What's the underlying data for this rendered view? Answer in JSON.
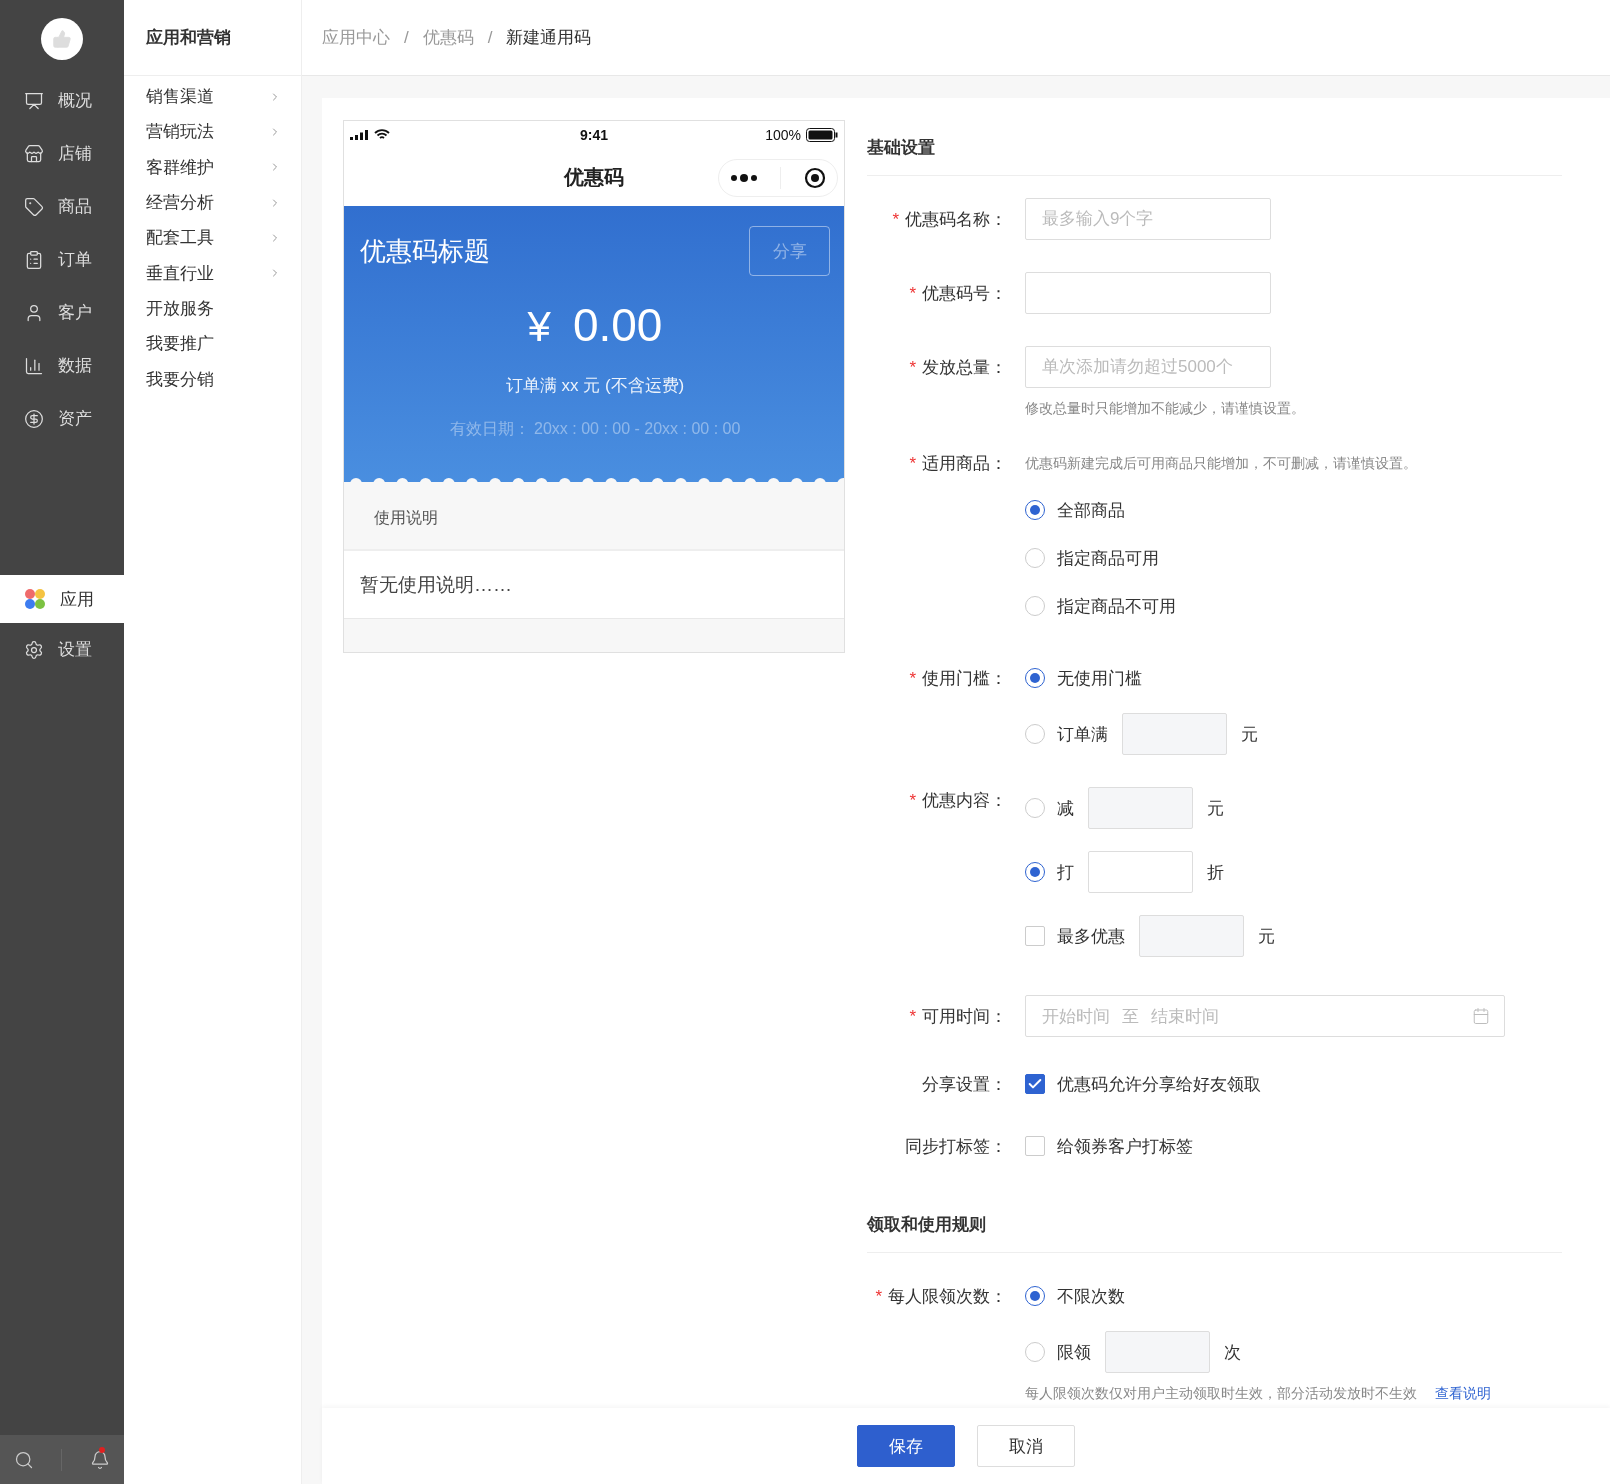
{
  "sidebar": {
    "items": [
      {
        "label": "概况",
        "kind": "overview",
        "selected": false
      },
      {
        "label": "店铺",
        "kind": "store",
        "selected": false
      },
      {
        "label": "商品",
        "kind": "goods",
        "selected": false
      },
      {
        "label": "订单",
        "kind": "order",
        "selected": false
      },
      {
        "label": "客户",
        "kind": "customer",
        "selected": false
      },
      {
        "label": "数据",
        "kind": "data",
        "selected": false
      },
      {
        "label": "资产",
        "kind": "asset",
        "selected": false
      },
      {
        "label": "应用",
        "kind": "apps",
        "selected": true
      },
      {
        "label": "设置",
        "kind": "settings",
        "selected": false
      }
    ],
    "notification_dot": true
  },
  "submenu": {
    "title": "应用和营销",
    "items": [
      {
        "label": "销售渠道",
        "has_children": true
      },
      {
        "label": "营销玩法",
        "has_children": true
      },
      {
        "label": "客群维护",
        "has_children": true
      },
      {
        "label": "经营分析",
        "has_children": true
      },
      {
        "label": "配套工具",
        "has_children": true
      },
      {
        "label": "垂直行业",
        "has_children": true
      },
      {
        "label": "开放服务",
        "has_children": false
      },
      {
        "label": "我要推广",
        "has_children": false
      },
      {
        "label": "我要分销",
        "has_children": false
      }
    ]
  },
  "breadcrumb": {
    "separator": "/",
    "items": [
      "应用中心",
      "优惠码",
      "新建通用码"
    ]
  },
  "preview": {
    "time": "9:41",
    "battery": "100%",
    "nav_title": "优惠码",
    "coupon_title": "优惠码标题",
    "share": "分享",
    "currency": "¥",
    "amount": "0.00",
    "condition": "订单满 xx 元 (不含运费)",
    "validity": "有效日期： 20xx : 00 : 00 - 20xx : 00 : 00",
    "usage_heading": "使用说明",
    "usage_text": "暂无使用说明……"
  },
  "sections": [
    {
      "title": "基础设置",
      "fields": [
        {
          "kind": "input",
          "label": "优惠码名称：",
          "marker": "*",
          "placeholder": "最多输入9个字"
        },
        {
          "kind": "input",
          "label": "优惠码号：",
          "marker": "*"
        },
        {
          "kind": "input",
          "label": "发放总量：",
          "marker": "*",
          "placeholder": "单次添加请勿超过5000个",
          "hint": "修改总量时只能增加不能减少，请谨慎设置。"
        },
        {
          "kind": "choices",
          "label": "适用商品：",
          "marker": "*",
          "note": "优惠码新建完成后可用商品只能增加，不可删减，请谨慎设置。",
          "options": [
            {
              "kind": "radio",
              "label": "全部商品",
              "selected": true
            },
            {
              "kind": "radio",
              "label": "指定商品可用",
              "selected": false
            },
            {
              "kind": "radio",
              "label": "指定商品不可用",
              "selected": false
            }
          ]
        },
        {
          "kind": "choices",
          "label": "使用门槛：",
          "marker": "*",
          "options": [
            {
              "kind": "radio",
              "label": "无使用门槛",
              "selected": true
            },
            {
              "kind": "radio",
              "label": "订单满",
              "selected": false,
              "unit": "元"
            }
          ]
        },
        {
          "kind": "choices",
          "label": "优惠内容：",
          "marker": "*",
          "options": [
            {
              "kind": "radio",
              "label": "减",
              "selected": false,
              "unit": "元"
            },
            {
              "kind": "radio",
              "label": "打",
              "selected": true,
              "unit": "折"
            },
            {
              "kind": "checkbox",
              "label": "最多优惠",
              "selected": false,
              "unit": "元"
            }
          ]
        },
        {
          "kind": "daterange",
          "label": "可用时间：",
          "marker": "*",
          "start": "开始时间",
          "joiner": "至",
          "end": "结束时间"
        },
        {
          "kind": "choices",
          "label": "分享设置：",
          "options": [
            {
              "kind": "checkbox",
              "label": "优惠码允许分享给好友领取",
              "selected": true
            }
          ]
        },
        {
          "kind": "choices",
          "label": "同步打标签：",
          "options": [
            {
              "kind": "checkbox",
              "label": "给领券客户打标签",
              "selected": false
            }
          ]
        }
      ]
    },
    {
      "title": "领取和使用规则",
      "fields": [
        {
          "kind": "choices",
          "label": "每人限领次数：",
          "marker": "*",
          "options": [
            {
              "kind": "radio",
              "label": "不限次数",
              "selected": true
            },
            {
              "kind": "radio",
              "label": "限领",
              "selected": false,
              "unit": "次"
            }
          ],
          "hint": "每人限领次数仅对用户主动领取时生效，部分活动发放时不生效",
          "hint_link": "查看说明"
        }
      ]
    }
  ],
  "footer": {
    "buttons": [
      {
        "label": "保存",
        "kind": "primary"
      },
      {
        "label": "取消",
        "kind": "default"
      }
    ]
  }
}
